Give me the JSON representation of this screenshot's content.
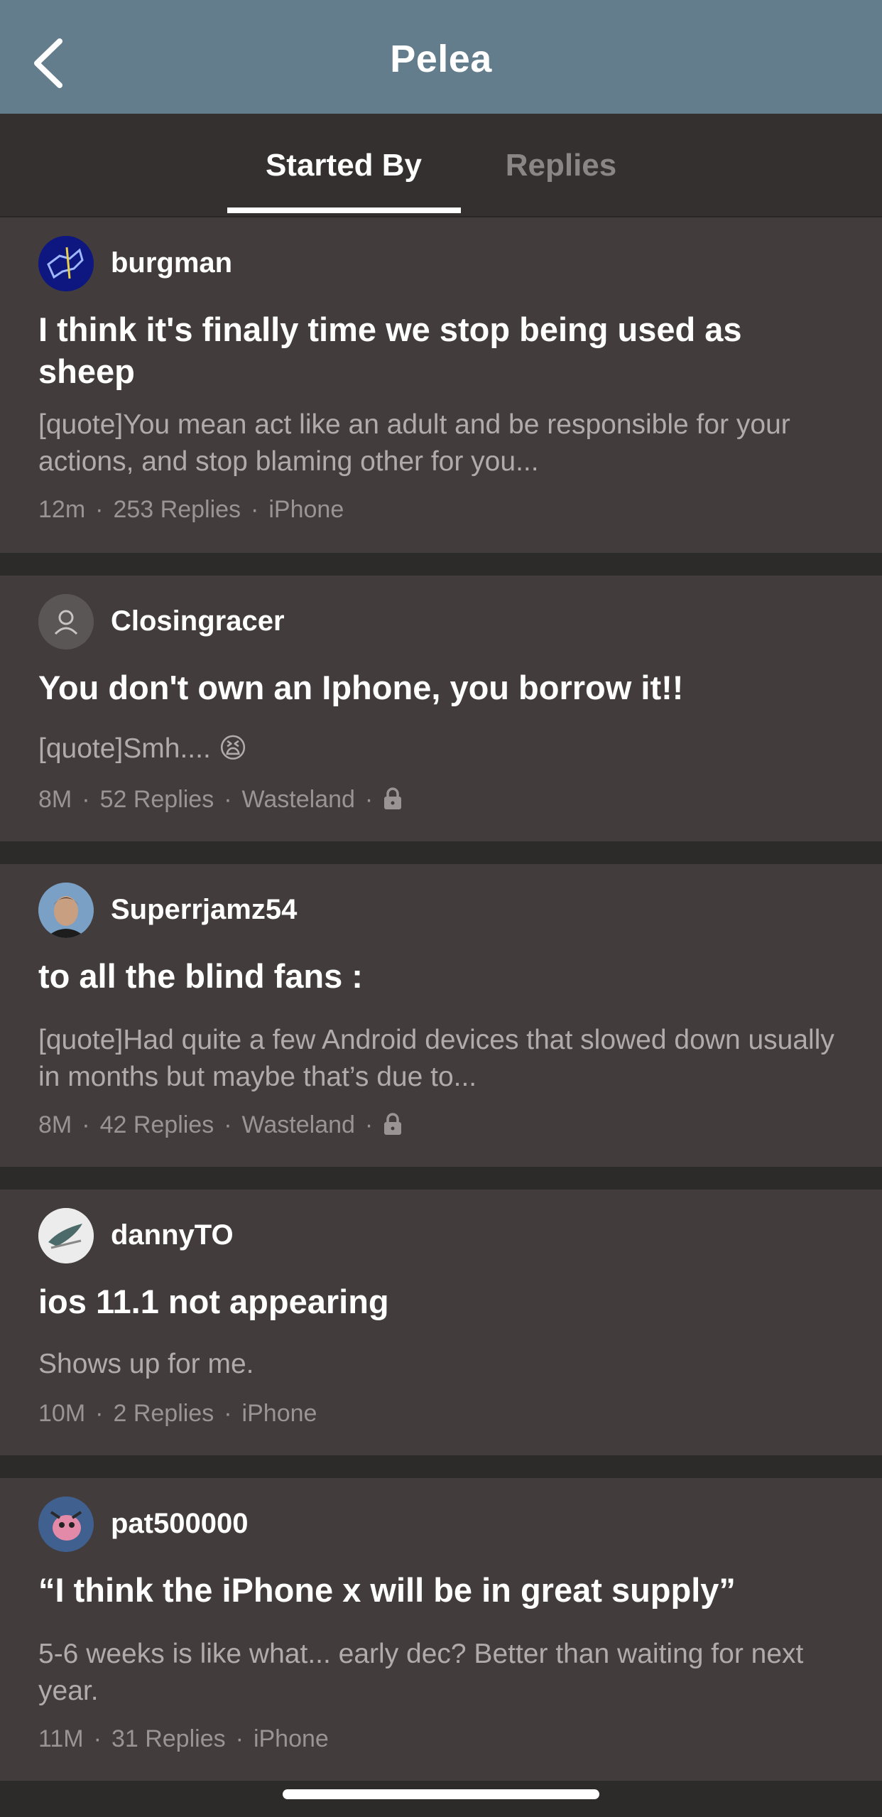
{
  "header": {
    "title": "Pelea",
    "back_icon": "chevron-left-icon"
  },
  "tabs": [
    {
      "label": "Started By",
      "active": true
    },
    {
      "label": "Replies",
      "active": false
    }
  ],
  "posts": [
    {
      "username": "burgman",
      "title": "I think it's finally time we stop being used as sheep",
      "excerpt": "[quote]You mean act like an adult and be responsible for your actions, and stop blaming other for you...",
      "time": "12m",
      "replies": "253 Replies",
      "forum": "iPhone",
      "locked": false
    },
    {
      "username": "Closingracer",
      "title": "You don't own an Iphone, you borrow it!!",
      "excerpt": "[quote]Smh.... 😫",
      "time": "8M",
      "replies": "52 Replies",
      "forum": "Wasteland",
      "locked": true
    },
    {
      "username": "Superrjamz54",
      "title": "to all the blind fans :",
      "excerpt": "[quote]Had quite a few Android devices that slowed down usually in months but maybe that’s due to...",
      "time": "8M",
      "replies": "42 Replies",
      "forum": "Wasteland",
      "locked": true
    },
    {
      "username": "dannyTO",
      "title": "ios 11.1 not appearing",
      "excerpt": "Shows up for me.",
      "time": "10M",
      "replies": "2 Replies",
      "forum": "iPhone",
      "locked": false
    },
    {
      "username": "pat500000",
      "title": "“I think the iPhone x will be in great supply”",
      "excerpt": "5-6 weeks is like what... early dec? Better than waiting for next year.",
      "time": "11M",
      "replies": "31 Replies",
      "forum": "iPhone",
      "locked": false
    }
  ],
  "meta_separator": "·",
  "colors": {
    "header_bg": "#637d8c",
    "tabs_bg": "#353030",
    "card_bg": "#423c3c",
    "page_bg": "#2d2a2a"
  }
}
